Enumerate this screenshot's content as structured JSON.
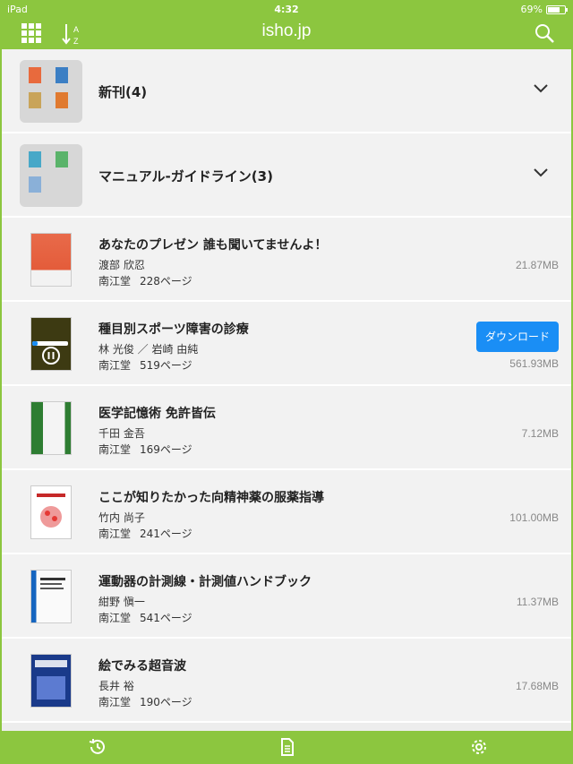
{
  "status_bar": {
    "carrier": "iPad",
    "time": "4:32",
    "battery": "69%"
  },
  "nav": {
    "title": "isho.jp"
  },
  "categories": [
    {
      "title": "新刊(4)"
    },
    {
      "title": "マニュアル-ガイドライン(3)"
    }
  ],
  "books": [
    {
      "title": "あなたのプレゼン 誰も聞いてませんよ！",
      "author": "渡部 欣忍",
      "publisher": "南江堂",
      "pages": "228ページ",
      "size": "21.87MB"
    },
    {
      "title": "種目別スポーツ障害の診療",
      "author": "林 光俊 ／ 岩崎 由純",
      "publisher": "南江堂",
      "pages": "519ページ",
      "size": "561.93MB",
      "action": "ダウンロード"
    },
    {
      "title": "医学記憶術 免許皆伝",
      "author": "千田 金吾",
      "publisher": "南江堂",
      "pages": "169ページ",
      "size": "7.12MB"
    },
    {
      "title": "ここが知りたかった向精神薬の服薬指導",
      "author": "竹内 尚子",
      "publisher": "南江堂",
      "pages": "241ページ",
      "size": "101.00MB"
    },
    {
      "title": "運動器の計測線・計測値ハンドブック",
      "author": "紺野 愼一",
      "publisher": "南江堂",
      "pages": "541ページ",
      "size": "11.37MB"
    },
    {
      "title": "絵でみる超音波",
      "author": "長井 裕",
      "publisher": "南江堂",
      "pages": "190ページ",
      "size": "17.68MB"
    }
  ],
  "colors": {
    "brand_green": "#8cc63f",
    "download_blue": "#1a8ef5"
  }
}
